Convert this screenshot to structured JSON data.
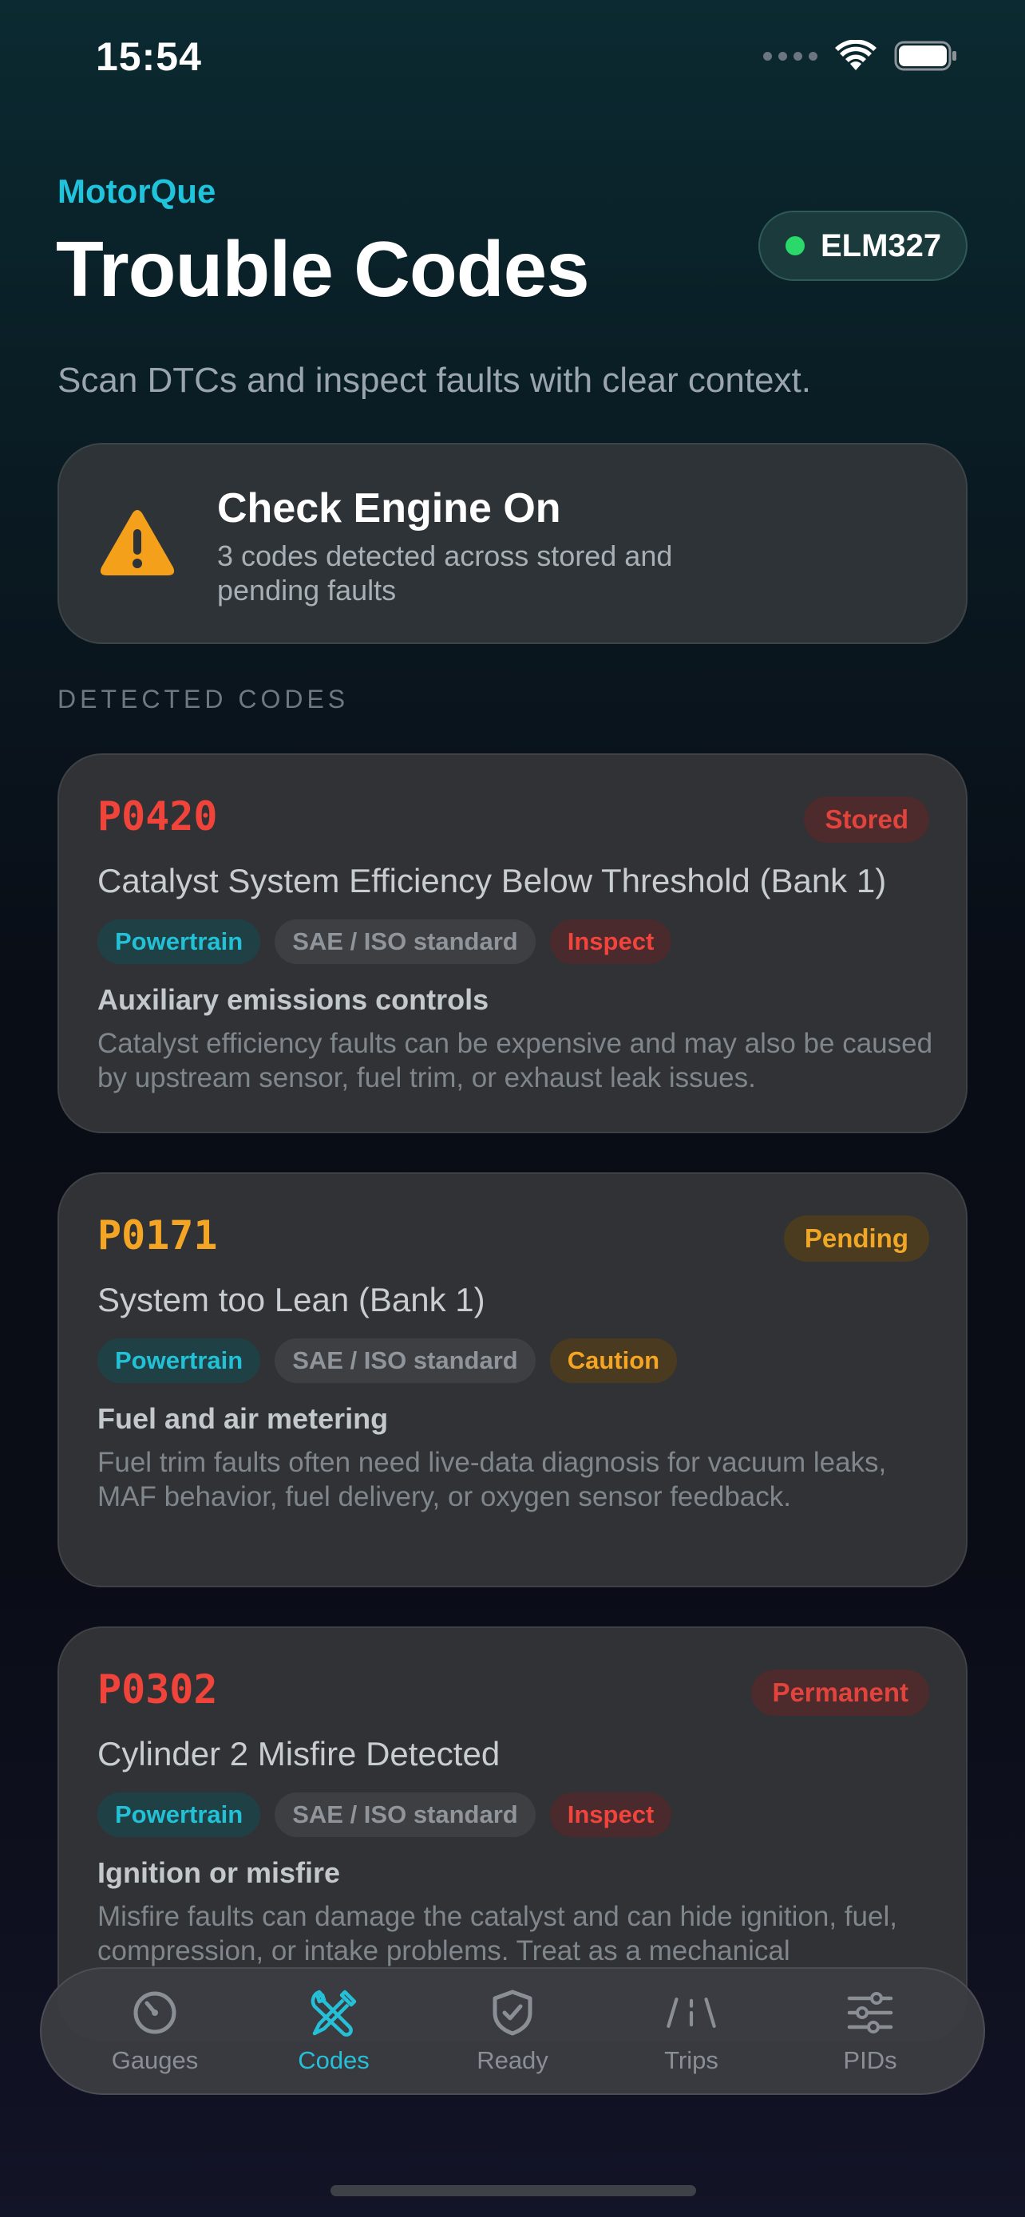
{
  "status_bar": {
    "time": "15:54"
  },
  "header": {
    "brand": "MotorQue",
    "title": "Trouble Codes",
    "subtitle": "Scan DTCs and inspect faults with clear context.",
    "connection": {
      "label": "ELM327",
      "status_color": "#2bd86a"
    }
  },
  "alert": {
    "icon": "warning-triangle-icon",
    "title": "Check Engine On",
    "description": "3 codes detected across stored and pending faults"
  },
  "section_label": "DETECTED CODES",
  "codes": [
    {
      "code": "P0420",
      "status": "Stored",
      "title": "Catalyst System Efficiency Below Threshold (Bank 1)",
      "tags": [
        "Powertrain",
        "SAE / ISO standard",
        "Inspect"
      ],
      "category": "Auxiliary emissions controls",
      "description": "Catalyst efficiency faults can be expensive and may also be caused by upstream sensor, fuel trim, or exhaust leak issues."
    },
    {
      "code": "P0171",
      "status": "Pending",
      "title": "System too Lean (Bank 1)",
      "tags": [
        "Powertrain",
        "SAE / ISO standard",
        "Caution"
      ],
      "category": "Fuel and air metering",
      "description": "Fuel trim faults often need live-data diagnosis for vacuum leaks, MAF behavior, fuel delivery, or oxygen sensor feedback."
    },
    {
      "code": "P0302",
      "status": "Permanent",
      "title": "Cylinder 2 Misfire Detected",
      "tags": [
        "Powertrain",
        "SAE / ISO standard",
        "Inspect"
      ],
      "category": "Ignition or misfire",
      "description": "Misfire faults can damage the catalyst and can hide ignition, fuel, compression, or intake problems. Treat as a mechanical"
    }
  ],
  "colors": {
    "accent": "#20c3dc",
    "error": "#f0433a",
    "warning": "#f5a524"
  },
  "tabs": [
    {
      "label": "Gauges",
      "icon": "gauge-icon",
      "active": false
    },
    {
      "label": "Codes",
      "icon": "wrench-screwdriver-icon",
      "active": true
    },
    {
      "label": "Ready",
      "icon": "shield-check-icon",
      "active": false
    },
    {
      "label": "Trips",
      "icon": "road-icon",
      "active": false
    },
    {
      "label": "PIDs",
      "icon": "sliders-icon",
      "active": false
    }
  ]
}
